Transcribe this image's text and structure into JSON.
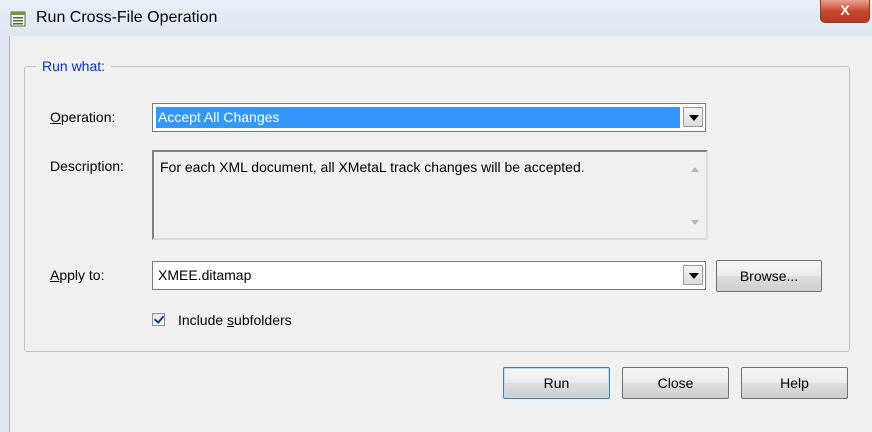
{
  "window": {
    "title": "Run Cross-File Operation",
    "close_glyph": "X",
    "icon": "document-list-icon"
  },
  "group": {
    "label": "Run what:"
  },
  "operation": {
    "label_underlined": "O",
    "label_rest": "peration:",
    "value": "Accept All Changes"
  },
  "description": {
    "label": "Description:",
    "text": "For each XML document, all XMetaL track changes will be accepted."
  },
  "apply_to": {
    "label_underlined": "A",
    "label_rest": "pply to:",
    "value": "XMEE.ditamap",
    "browse_label": "Browse..."
  },
  "include_subfolders": {
    "label_pre": "Include ",
    "label_underlined": "s",
    "label_post": "ubfolders",
    "checked": true
  },
  "buttons": {
    "run": "Run",
    "close": "Close",
    "help": "Help"
  },
  "colors": {
    "selection": "#3399ff",
    "group_label": "#0033cc",
    "close_button": "#c7492f"
  }
}
